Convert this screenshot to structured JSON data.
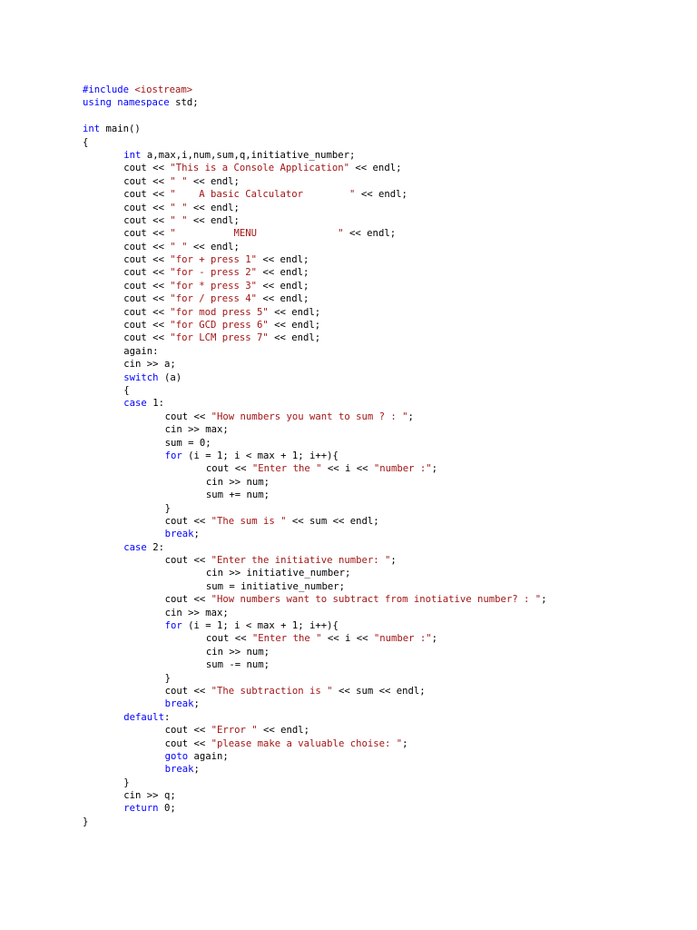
{
  "colors": {
    "background": "#ffffff",
    "plain": "#000000",
    "keyword": "#0000ff",
    "string": "#a31515"
  },
  "document": {
    "lines": [
      {
        "indent": 0,
        "tokens": [
          {
            "t": "kw",
            "v": "#include "
          },
          {
            "t": "str",
            "v": "<iostream>"
          }
        ]
      },
      {
        "indent": 0,
        "tokens": [
          {
            "t": "kw",
            "v": "using"
          },
          {
            "t": "plain",
            "v": " "
          },
          {
            "t": "kw",
            "v": "namespace"
          },
          {
            "t": "plain",
            "v": " std;"
          }
        ]
      },
      {
        "indent": 0,
        "tokens": []
      },
      {
        "indent": 0,
        "tokens": [
          {
            "t": "kw",
            "v": "int"
          },
          {
            "t": "plain",
            "v": " main()"
          }
        ]
      },
      {
        "indent": 0,
        "tokens": [
          {
            "t": "plain",
            "v": "{"
          }
        ]
      },
      {
        "indent": 1,
        "tokens": [
          {
            "t": "kw",
            "v": "int"
          },
          {
            "t": "plain",
            "v": " a,max,i,num,sum,q,initiative_number;"
          }
        ]
      },
      {
        "indent": 1,
        "tokens": [
          {
            "t": "plain",
            "v": "cout << "
          },
          {
            "t": "str",
            "v": "\"This is a Console Application\""
          },
          {
            "t": "plain",
            "v": " << endl;"
          }
        ]
      },
      {
        "indent": 1,
        "tokens": [
          {
            "t": "plain",
            "v": "cout << "
          },
          {
            "t": "str",
            "v": "\" \""
          },
          {
            "t": "plain",
            "v": " << endl;"
          }
        ]
      },
      {
        "indent": 1,
        "tokens": [
          {
            "t": "plain",
            "v": "cout << "
          },
          {
            "t": "str",
            "v": "\"    A basic Calculator        \""
          },
          {
            "t": "plain",
            "v": " << endl;"
          }
        ]
      },
      {
        "indent": 1,
        "tokens": [
          {
            "t": "plain",
            "v": "cout << "
          },
          {
            "t": "str",
            "v": "\" \""
          },
          {
            "t": "plain",
            "v": " << endl;"
          }
        ]
      },
      {
        "indent": 1,
        "tokens": [
          {
            "t": "plain",
            "v": "cout << "
          },
          {
            "t": "str",
            "v": "\" \""
          },
          {
            "t": "plain",
            "v": " << endl;"
          }
        ]
      },
      {
        "indent": 1,
        "tokens": [
          {
            "t": "plain",
            "v": "cout << "
          },
          {
            "t": "str",
            "v": "\"          MENU              \""
          },
          {
            "t": "plain",
            "v": " << endl;"
          }
        ]
      },
      {
        "indent": 1,
        "tokens": [
          {
            "t": "plain",
            "v": "cout << "
          },
          {
            "t": "str",
            "v": "\" \""
          },
          {
            "t": "plain",
            "v": " << endl;"
          }
        ]
      },
      {
        "indent": 1,
        "tokens": [
          {
            "t": "plain",
            "v": "cout << "
          },
          {
            "t": "str",
            "v": "\"for + press 1\""
          },
          {
            "t": "plain",
            "v": " << endl;"
          }
        ]
      },
      {
        "indent": 1,
        "tokens": [
          {
            "t": "plain",
            "v": "cout << "
          },
          {
            "t": "str",
            "v": "\"for - press 2\""
          },
          {
            "t": "plain",
            "v": " << endl;"
          }
        ]
      },
      {
        "indent": 1,
        "tokens": [
          {
            "t": "plain",
            "v": "cout << "
          },
          {
            "t": "str",
            "v": "\"for * press 3\""
          },
          {
            "t": "plain",
            "v": " << endl;"
          }
        ]
      },
      {
        "indent": 1,
        "tokens": [
          {
            "t": "plain",
            "v": "cout << "
          },
          {
            "t": "str",
            "v": "\"for / press 4\""
          },
          {
            "t": "plain",
            "v": " << endl;"
          }
        ]
      },
      {
        "indent": 1,
        "tokens": [
          {
            "t": "plain",
            "v": "cout << "
          },
          {
            "t": "str",
            "v": "\"for mod press 5\""
          },
          {
            "t": "plain",
            "v": " << endl;"
          }
        ]
      },
      {
        "indent": 1,
        "tokens": [
          {
            "t": "plain",
            "v": "cout << "
          },
          {
            "t": "str",
            "v": "\"for GCD press 6\""
          },
          {
            "t": "plain",
            "v": " << endl;"
          }
        ]
      },
      {
        "indent": 1,
        "tokens": [
          {
            "t": "plain",
            "v": "cout << "
          },
          {
            "t": "str",
            "v": "\"for LCM press 7\""
          },
          {
            "t": "plain",
            "v": " << endl;"
          }
        ]
      },
      {
        "indent": 1,
        "tokens": [
          {
            "t": "plain",
            "v": "again:"
          }
        ]
      },
      {
        "indent": 1,
        "tokens": [
          {
            "t": "plain",
            "v": "cin >> a;"
          }
        ]
      },
      {
        "indent": 1,
        "tokens": [
          {
            "t": "kw",
            "v": "switch"
          },
          {
            "t": "plain",
            "v": " (a)"
          }
        ]
      },
      {
        "indent": 1,
        "tokens": [
          {
            "t": "plain",
            "v": "{"
          }
        ]
      },
      {
        "indent": 1,
        "tokens": [
          {
            "t": "kw",
            "v": "case"
          },
          {
            "t": "plain",
            "v": " 1:"
          }
        ]
      },
      {
        "indent": 2,
        "tokens": [
          {
            "t": "plain",
            "v": "cout << "
          },
          {
            "t": "str",
            "v": "\"How numbers you want to sum ? : \""
          },
          {
            "t": "plain",
            "v": ";"
          }
        ]
      },
      {
        "indent": 2,
        "tokens": [
          {
            "t": "plain",
            "v": "cin >> max;"
          }
        ]
      },
      {
        "indent": 2,
        "tokens": [
          {
            "t": "plain",
            "v": "sum = 0;"
          }
        ]
      },
      {
        "indent": 2,
        "tokens": [
          {
            "t": "kw",
            "v": "for"
          },
          {
            "t": "plain",
            "v": " (i = 1; i < max + 1; i++){"
          }
        ]
      },
      {
        "indent": 3,
        "tokens": [
          {
            "t": "plain",
            "v": "cout << "
          },
          {
            "t": "str",
            "v": "\"Enter the \""
          },
          {
            "t": "plain",
            "v": " << i << "
          },
          {
            "t": "str",
            "v": "\"number :\""
          },
          {
            "t": "plain",
            "v": ";"
          }
        ]
      },
      {
        "indent": 3,
        "tokens": [
          {
            "t": "plain",
            "v": "cin >> num;"
          }
        ]
      },
      {
        "indent": 3,
        "tokens": [
          {
            "t": "plain",
            "v": "sum += num;"
          }
        ]
      },
      {
        "indent": 2,
        "tokens": [
          {
            "t": "plain",
            "v": "}"
          }
        ]
      },
      {
        "indent": 2,
        "tokens": [
          {
            "t": "plain",
            "v": "cout << "
          },
          {
            "t": "str",
            "v": "\"The sum is \""
          },
          {
            "t": "plain",
            "v": " << sum << endl;"
          }
        ]
      },
      {
        "indent": 2,
        "tokens": [
          {
            "t": "kw",
            "v": "break"
          },
          {
            "t": "plain",
            "v": ";"
          }
        ]
      },
      {
        "indent": 1,
        "tokens": [
          {
            "t": "kw",
            "v": "case"
          },
          {
            "t": "plain",
            "v": " 2:"
          }
        ]
      },
      {
        "indent": 2,
        "tokens": [
          {
            "t": "plain",
            "v": "cout << "
          },
          {
            "t": "str",
            "v": "\"Enter the initiative number: \""
          },
          {
            "t": "plain",
            "v": ";"
          }
        ]
      },
      {
        "indent": 3,
        "tokens": [
          {
            "t": "plain",
            "v": "cin >> initiative_number;"
          }
        ]
      },
      {
        "indent": 3,
        "tokens": [
          {
            "t": "plain",
            "v": "sum = initiative_number;"
          }
        ]
      },
      {
        "indent": 2,
        "tokens": [
          {
            "t": "plain",
            "v": "cout << "
          },
          {
            "t": "str",
            "v": "\"How numbers want to subtract from inotiative number? : \""
          },
          {
            "t": "plain",
            "v": ";"
          }
        ]
      },
      {
        "indent": 2,
        "tokens": [
          {
            "t": "plain",
            "v": "cin >> max;"
          }
        ]
      },
      {
        "indent": 2,
        "tokens": [
          {
            "t": "kw",
            "v": "for"
          },
          {
            "t": "plain",
            "v": " (i = 1; i < max + 1; i++){"
          }
        ]
      },
      {
        "indent": 3,
        "tokens": [
          {
            "t": "plain",
            "v": "cout << "
          },
          {
            "t": "str",
            "v": "\"Enter the \""
          },
          {
            "t": "plain",
            "v": " << i << "
          },
          {
            "t": "str",
            "v": "\"number :\""
          },
          {
            "t": "plain",
            "v": ";"
          }
        ]
      },
      {
        "indent": 3,
        "tokens": [
          {
            "t": "plain",
            "v": "cin >> num;"
          }
        ]
      },
      {
        "indent": 3,
        "tokens": [
          {
            "t": "plain",
            "v": "sum -= num;"
          }
        ]
      },
      {
        "indent": 2,
        "tokens": [
          {
            "t": "plain",
            "v": "}"
          }
        ]
      },
      {
        "indent": 2,
        "tokens": [
          {
            "t": "plain",
            "v": "cout << "
          },
          {
            "t": "str",
            "v": "\"The subtraction is \""
          },
          {
            "t": "plain",
            "v": " << sum << endl;"
          }
        ]
      },
      {
        "indent": 2,
        "tokens": [
          {
            "t": "kw",
            "v": "break"
          },
          {
            "t": "plain",
            "v": ";"
          }
        ]
      },
      {
        "indent": 1,
        "tokens": [
          {
            "t": "kw",
            "v": "default"
          },
          {
            "t": "plain",
            "v": ":"
          }
        ]
      },
      {
        "indent": 2,
        "tokens": [
          {
            "t": "plain",
            "v": "cout << "
          },
          {
            "t": "str",
            "v": "\"Error \""
          },
          {
            "t": "plain",
            "v": " << endl;"
          }
        ]
      },
      {
        "indent": 2,
        "tokens": [
          {
            "t": "plain",
            "v": "cout << "
          },
          {
            "t": "str",
            "v": "\"please make a valuable choise: \""
          },
          {
            "t": "plain",
            "v": ";"
          }
        ]
      },
      {
        "indent": 2,
        "tokens": [
          {
            "t": "kw",
            "v": "goto"
          },
          {
            "t": "plain",
            "v": " again;"
          }
        ]
      },
      {
        "indent": 2,
        "tokens": [
          {
            "t": "kw",
            "v": "break"
          },
          {
            "t": "plain",
            "v": ";"
          }
        ]
      },
      {
        "indent": 1,
        "tokens": [
          {
            "t": "plain",
            "v": "}"
          }
        ]
      },
      {
        "indent": 1,
        "tokens": [
          {
            "t": "plain",
            "v": "cin >> q;"
          }
        ]
      },
      {
        "indent": 1,
        "tokens": [
          {
            "t": "kw",
            "v": "return"
          },
          {
            "t": "plain",
            "v": " 0;"
          }
        ]
      },
      {
        "indent": 0,
        "tokens": [
          {
            "t": "plain",
            "v": "}"
          }
        ]
      }
    ]
  }
}
